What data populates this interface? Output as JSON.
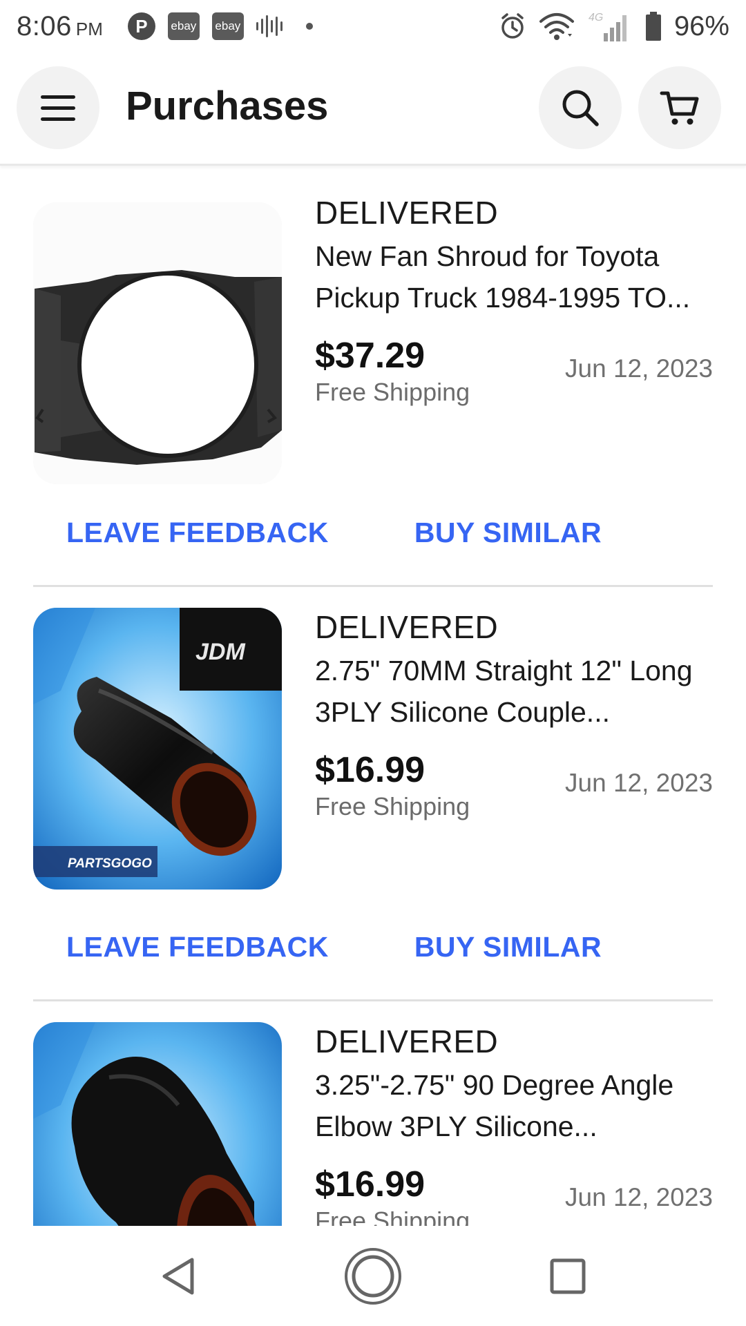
{
  "status_bar": {
    "time": "8:06",
    "ampm": "PM",
    "notif_p": "P",
    "notif_ebay_1": "ebay",
    "notif_ebay_2": "ebay",
    "network": "4G",
    "battery": "96%"
  },
  "header": {
    "title": "Purchases",
    "icons": [
      "menu-icon",
      "search-icon",
      "cart-icon"
    ]
  },
  "orders": [
    {
      "status": "DELIVERED",
      "title": "New Fan Shroud for Toyota Pickup Truck 1984-1995 TO...",
      "price": "$37.29",
      "shipping": "Free Shipping",
      "date": "Jun 12, 2023",
      "feedback_label": "LEAVE FEEDBACK",
      "similar_label": "BUY SIMILAR"
    },
    {
      "status": "DELIVERED",
      "title": "2.75\" 70MM Straight 12\" Long 3PLY Silicone Couple...",
      "price": "$16.99",
      "shipping": "Free Shipping",
      "date": "Jun 12, 2023",
      "feedback_label": "LEAVE FEEDBACK",
      "similar_label": "BUY SIMILAR",
      "image_text": {
        "brand": "JDM",
        "store": "PARTSGOGO"
      }
    },
    {
      "status": "DELIVERED",
      "title": "3.25\"-2.75\" 90 Degree Angle Elbow 3PLY Silicone...",
      "price": "$16.99",
      "shipping": "Free Shipping",
      "date": "Jun 12, 2023"
    }
  ],
  "colors": {
    "link": "#3665f3",
    "text": "#191919",
    "muted": "#707070"
  }
}
